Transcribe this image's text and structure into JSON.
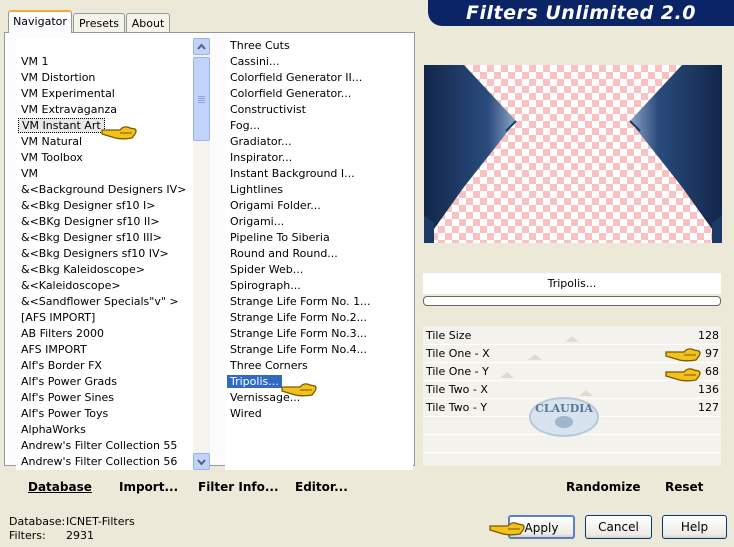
{
  "title": "Filters Unlimited 2.0",
  "tabs": [
    {
      "label": "Navigator",
      "active": true
    },
    {
      "label": "Presets",
      "active": false
    },
    {
      "label": "About",
      "active": false
    }
  ],
  "categories": [
    {
      "label": "VM 1"
    },
    {
      "label": "VM Distortion"
    },
    {
      "label": "VM Experimental"
    },
    {
      "label": "VM Extravaganza"
    },
    {
      "label": "VM Instant Art",
      "selected": true
    },
    {
      "label": "VM Natural"
    },
    {
      "label": "VM Toolbox"
    },
    {
      "label": "VM"
    },
    {
      "label": "&<Background Designers IV>"
    },
    {
      "label": "&<Bkg Designer sf10 I>"
    },
    {
      "label": "&<BKg Designer sf10 II>"
    },
    {
      "label": "&<Bkg Designer sf10 III>"
    },
    {
      "label": "&<Bkg Designers sf10 IV>"
    },
    {
      "label": "&<Bkg Kaleidoscope>"
    },
    {
      "label": "&<Kaleidoscope>"
    },
    {
      "label": "&<Sandflower Specials\"v\" >"
    },
    {
      "label": "[AFS IMPORT]"
    },
    {
      "label": "AB Filters 2000"
    },
    {
      "label": "AFS IMPORT"
    },
    {
      "label": "Alf's Border FX"
    },
    {
      "label": "Alf's Power Grads"
    },
    {
      "label": "Alf's Power Sines"
    },
    {
      "label": "Alf's Power Toys"
    },
    {
      "label": "AlphaWorks"
    },
    {
      "label": "Andrew's Filter Collection 55"
    },
    {
      "label": "Andrew's Filter Collection 56"
    }
  ],
  "filters": [
    {
      "label": "Three Cuts"
    },
    {
      "label": "Cassini..."
    },
    {
      "label": "Colorfield Generator II..."
    },
    {
      "label": "Colorfield Generator..."
    },
    {
      "label": "Constructivist"
    },
    {
      "label": "Fog..."
    },
    {
      "label": "Gradiator..."
    },
    {
      "label": "Inspirator..."
    },
    {
      "label": "Instant Background I..."
    },
    {
      "label": "Lightlines"
    },
    {
      "label": "Origami Folder..."
    },
    {
      "label": "Origami..."
    },
    {
      "label": "Pipeline To Siberia"
    },
    {
      "label": "Round and Round..."
    },
    {
      "label": "Spider Web..."
    },
    {
      "label": "Spirograph..."
    },
    {
      "label": "Strange Life Form No. 1..."
    },
    {
      "label": "Strange Life Form No.2..."
    },
    {
      "label": "Strange Life Form No.3..."
    },
    {
      "label": "Strange Life Form No.4..."
    },
    {
      "label": "Three Corners"
    },
    {
      "label": "Tripolis...",
      "highlighted": true
    },
    {
      "label": "Vernissage..."
    },
    {
      "label": "Wired"
    }
  ],
  "selected_filter": "Tripolis...",
  "parameters": [
    {
      "label": "Tile Size",
      "value": "128"
    },
    {
      "label": "Tile One - X",
      "value": "97"
    },
    {
      "label": "Tile One - Y",
      "value": "68"
    },
    {
      "label": "Tile Two - X",
      "value": "136"
    },
    {
      "label": "Tile Two - Y",
      "value": "127"
    }
  ],
  "bottom_links": {
    "database": "Database",
    "import": "Import...",
    "filter_info": "Filter Info...",
    "editor": "Editor...",
    "randomize": "Randomize",
    "reset": "Reset"
  },
  "status": {
    "database_label": "Database:",
    "database_value": "ICNET-Filters",
    "filters_label": "Filters:",
    "filters_value": "2931"
  },
  "buttons": {
    "apply": "Apply",
    "cancel": "Cancel",
    "help": "Help"
  },
  "watermark": "CLAUDIA",
  "colors": {
    "banner": "#0a2466",
    "selection": "#316ac5",
    "checker_pink": "#f8c2c2",
    "preview_navy": "#1c3a66"
  }
}
